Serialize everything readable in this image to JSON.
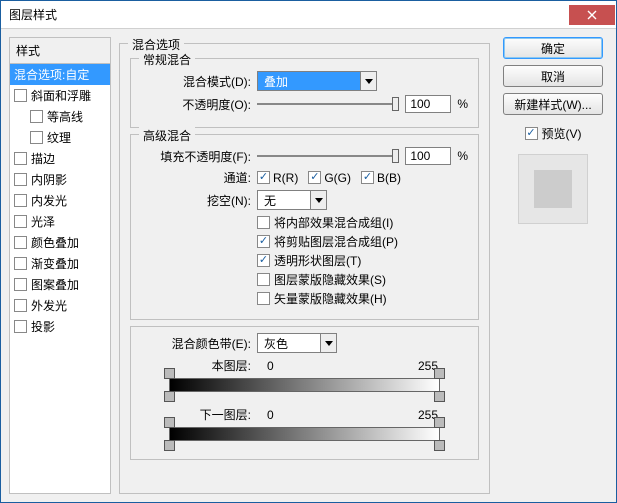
{
  "title": "图层样式",
  "buttons": {
    "ok": "确定",
    "cancel": "取消",
    "new_style": "新建样式(W)..."
  },
  "preview": {
    "label": "预览(V)",
    "checked": true
  },
  "left": {
    "header": "样式",
    "selected": "混合选项:自定",
    "items": [
      {
        "label": "斜面和浮雕",
        "checked": false,
        "indent": 0
      },
      {
        "label": "等高线",
        "checked": false,
        "indent": 1
      },
      {
        "label": "纹理",
        "checked": false,
        "indent": 1
      },
      {
        "label": "描边",
        "checked": false,
        "indent": 0
      },
      {
        "label": "内阴影",
        "checked": false,
        "indent": 0
      },
      {
        "label": "内发光",
        "checked": false,
        "indent": 0
      },
      {
        "label": "光泽",
        "checked": false,
        "indent": 0
      },
      {
        "label": "颜色叠加",
        "checked": false,
        "indent": 0
      },
      {
        "label": "渐变叠加",
        "checked": false,
        "indent": 0
      },
      {
        "label": "图案叠加",
        "checked": false,
        "indent": 0
      },
      {
        "label": "外发光",
        "checked": false,
        "indent": 0
      },
      {
        "label": "投影",
        "checked": false,
        "indent": 0
      }
    ]
  },
  "blend_opts": {
    "legend": "混合选项",
    "general": {
      "legend": "常规混合",
      "mode_label": "混合模式(D):",
      "mode_value": "叠加",
      "opacity_label": "不透明度(O):",
      "opacity_value": "100",
      "opacity_pct": "%"
    },
    "advanced": {
      "legend": "高级混合",
      "fill_label": "填充不透明度(F):",
      "fill_value": "100",
      "fill_pct": "%",
      "channels_label": "通道:",
      "r": "R(R)",
      "g": "G(G)",
      "b": "B(B)",
      "knockout_label": "挖空(N):",
      "knockout_value": "无",
      "opts": [
        {
          "label": "将内部效果混合成组(I)",
          "checked": false
        },
        {
          "label": "将剪贴图层混合成组(P)",
          "checked": true
        },
        {
          "label": "透明形状图层(T)",
          "checked": true
        },
        {
          "label": "图层蒙版隐藏效果(S)",
          "checked": false
        },
        {
          "label": "矢量蒙版隐藏效果(H)",
          "checked": false
        }
      ]
    },
    "blendif": {
      "label": "混合颜色带(E):",
      "value": "灰色",
      "this_layer": "本图层:",
      "this_lo": "0",
      "this_hi": "255",
      "under_layer": "下一图层:",
      "under_lo": "0",
      "under_hi": "255"
    }
  }
}
